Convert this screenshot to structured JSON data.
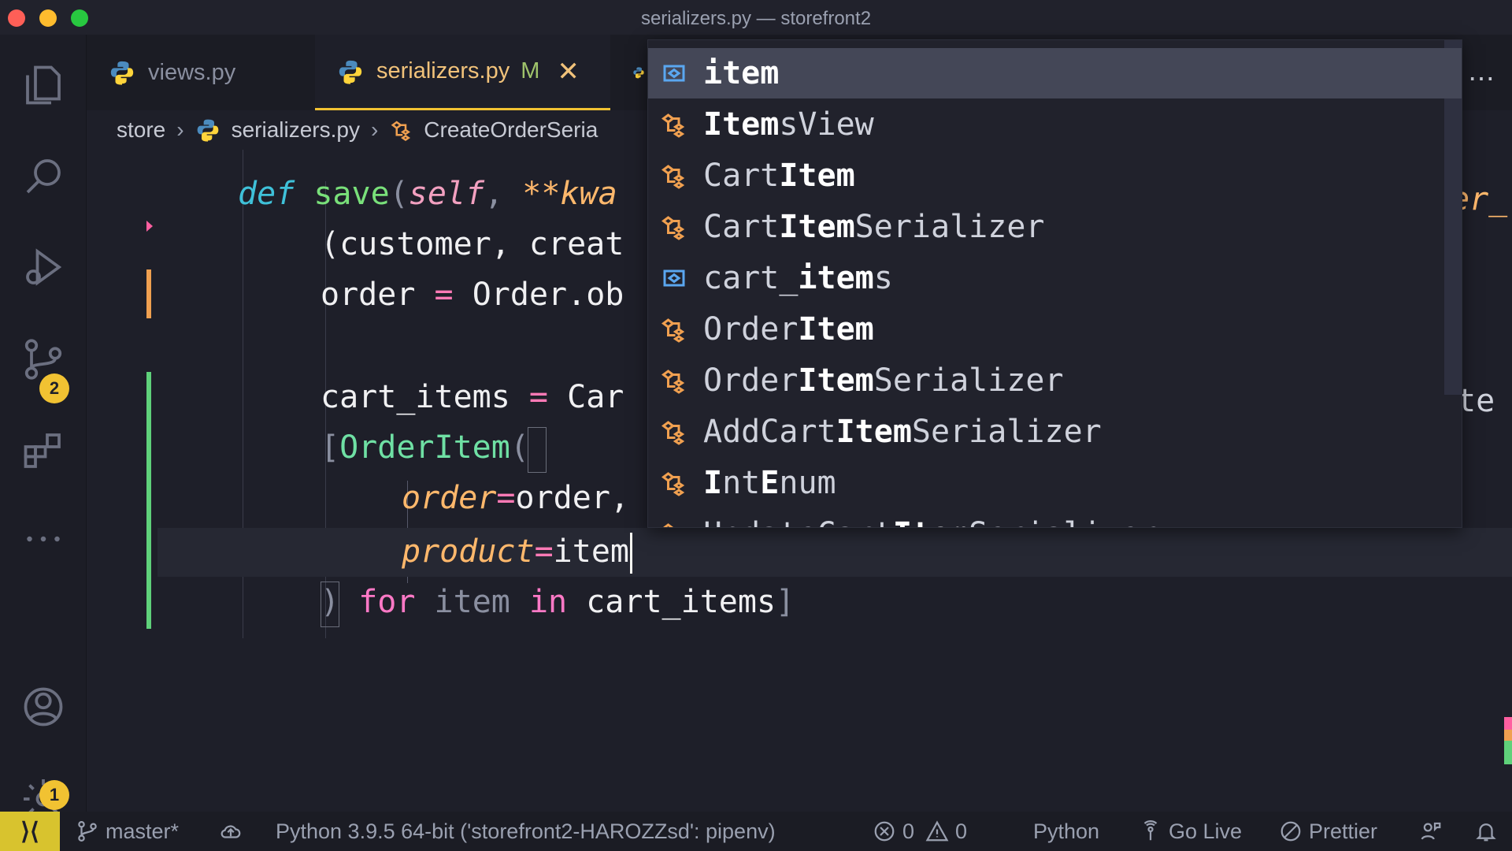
{
  "window": {
    "title": "serializers.py — storefront2"
  },
  "activity_bar": {
    "source_control_badge": "2",
    "settings_badge": "1"
  },
  "tabs": [
    {
      "label": "views.py"
    },
    {
      "label": "serializers.py",
      "modified": "M"
    }
  ],
  "breadcrumb": {
    "folder": "store",
    "file": "serializers.py",
    "symbol": "CreateOrderSeria"
  },
  "code": {
    "line1": {
      "kw": "def",
      "fn": "save",
      "params": "self",
      "rest": "**kwa"
    },
    "line2": "(customer, creat",
    "line3_a": "order",
    "line3_b": "Order.ob",
    "line4_a": "cart_items",
    "line4_b": "Car",
    "line5_cls": "OrderItem",
    "line6_kwarg": "order",
    "line6_val": "order,",
    "line7_kwarg": "product",
    "line7_val": "item",
    "line8_for": "for",
    "line8_item": "item",
    "line8_in": "in",
    "line8_list": "cart_items",
    "right_frag1": "er_",
    "right_frag2": "te"
  },
  "suggestions": [
    {
      "pre": "",
      "match": "item",
      "post": "",
      "kind": "variable"
    },
    {
      "pre": "",
      "match": "Item",
      "post": "sView",
      "kind": "class"
    },
    {
      "pre": "Cart",
      "match": "Item",
      "post": "",
      "kind": "class"
    },
    {
      "pre": "Cart",
      "match": "Item",
      "post": "Serializer",
      "kind": "class"
    },
    {
      "pre": "cart_",
      "match": "item",
      "post": "s",
      "kind": "variable"
    },
    {
      "pre": "Order",
      "match": "Item",
      "post": "",
      "kind": "class"
    },
    {
      "pre": "Order",
      "match": "Item",
      "post": "Serializer",
      "kind": "class"
    },
    {
      "pre": "AddCart",
      "match": "Item",
      "post": "Serializer",
      "kind": "class"
    },
    {
      "pre": "",
      "match": "I",
      "post": "ntEnum",
      "kind": "class",
      "match2": "E"
    },
    {
      "pre": "UpdateCart",
      "match": "Item",
      "post": "Serializer",
      "kind": "class"
    }
  ],
  "statusbar": {
    "branch": "master*",
    "interpreter": "Python 3.9.5 64-bit ('storefront2-HAROZZsd': pipenv)",
    "errors": "0",
    "warnings": "0",
    "language": "Python",
    "go_live": "Go Live",
    "prettier": "Prettier"
  },
  "colors": {
    "accent": "#f1c232",
    "keyword": "#ff79c6",
    "class": "#6fe0a4",
    "function": "#79e07a",
    "kwarg": "#ffb86c"
  }
}
